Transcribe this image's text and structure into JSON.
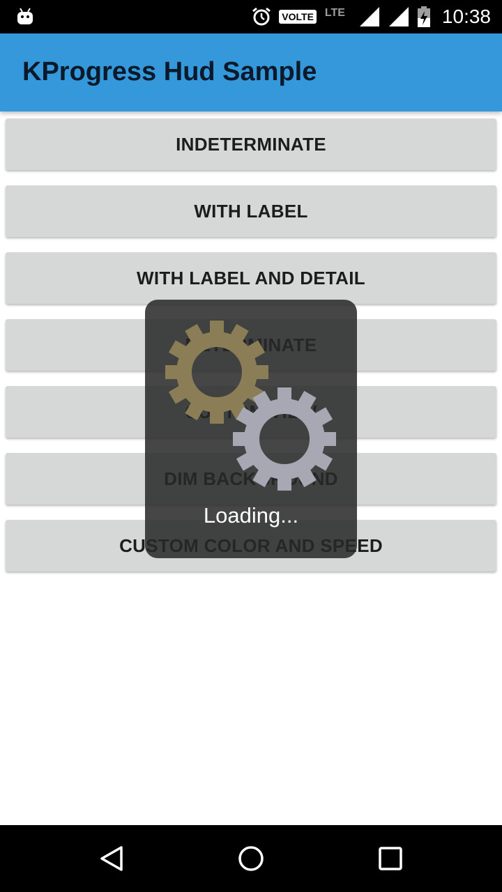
{
  "status_bar": {
    "time": "10:38",
    "volte": "VOLTE",
    "network": "LTE",
    "icons": [
      "android-icon",
      "alarm-icon",
      "signal-icon",
      "signal-icon",
      "battery-icon"
    ]
  },
  "app_bar": {
    "title": "KProgress Hud Sample",
    "color": "#3498db"
  },
  "buttons": [
    {
      "label": "INDETERMINATE"
    },
    {
      "label": "WITH LABEL"
    },
    {
      "label": "WITH LABEL AND DETAIL"
    },
    {
      "label": "DETERMINATE"
    },
    {
      "label": "CUSTOM VIEW"
    },
    {
      "label": "DIM BACKGROUND"
    },
    {
      "label": "CUSTOM COLOR AND SPEED"
    }
  ],
  "hud": {
    "label": "Loading...",
    "gear_colors": [
      "#8b7d55",
      "#a8a8b4"
    ]
  },
  "nav_bar": {
    "icons": [
      "back-icon",
      "home-icon",
      "recents-icon"
    ]
  }
}
